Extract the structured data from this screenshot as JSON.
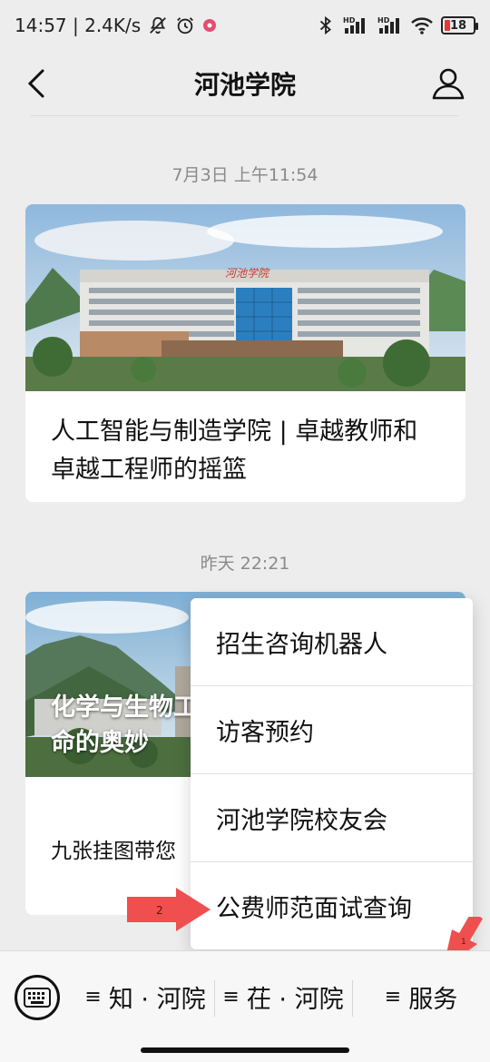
{
  "status_bar": {
    "left_text": "14:57 | 2.4K/s",
    "battery": "18",
    "hd_label": "HD"
  },
  "nav": {
    "title": "河池学院"
  },
  "messages": [
    {
      "timestamp": "7月3日 上午11:54",
      "building_sign": "河池学院",
      "title": "人工智能与制造学院 | 卓越教师和卓越工程师的摇篮"
    },
    {
      "timestamp": "昨天 22:21",
      "image_text": [
        "化学与生物工",
        "命的奥妙"
      ],
      "summary": "九张挂图带您"
    }
  ],
  "popup_menu": {
    "items": [
      {
        "label": "招生咨询机器人"
      },
      {
        "label": "访客预约"
      },
      {
        "label": "河池学院校友会"
      },
      {
        "label": "公费师范面试查询"
      }
    ]
  },
  "bottom_menu": {
    "tabs": [
      {
        "label": "知 · 河院"
      },
      {
        "label": "茌 · 河院"
      },
      {
        "label": "服务"
      }
    ],
    "menu_glyph": "≡"
  },
  "annotations": {
    "arrow_1_label": "1",
    "arrow_2_label": "2"
  },
  "colors": {
    "background": "#ededed",
    "card": "#ffffff",
    "annotation_arrow": "#ef4f4f",
    "battery_low": "#e53935"
  }
}
